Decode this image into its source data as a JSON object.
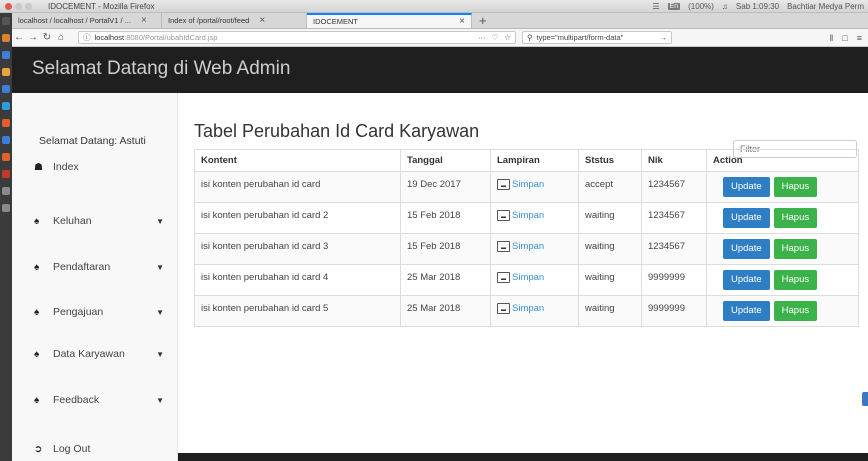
{
  "os": {
    "window_title": "IDOCEMENT - Mozilla Firefox",
    "battery": "(100%)",
    "clock": "Sab 1:09:30",
    "user": "Bachtiar Medya Perm",
    "lang": "En"
  },
  "browser": {
    "tabs": [
      {
        "label": "localhost / localhost / PortalV1 / ..."
      },
      {
        "label": "Index of /portal/root/feed"
      },
      {
        "label": "IDOCEMENT"
      }
    ],
    "url_host": "localhost",
    "url_path": ":8080/Portal/ubahIdCard.jsp",
    "search_text": "type=\"multipart/form-data\""
  },
  "header": {
    "title": "Selamat Datang di Web Admin"
  },
  "sidebar": {
    "greeting": "Selamat Datang: Astuti",
    "items": [
      {
        "label": "Index",
        "icon": "home-icon",
        "caret": false
      },
      {
        "label": "Keluhan",
        "icon": "users-icon",
        "caret": true
      },
      {
        "label": "Pendaftaran",
        "icon": "users-icon",
        "caret": true
      },
      {
        "label": "Pengajuan",
        "icon": "users-icon",
        "caret": true
      },
      {
        "label": "Data Karyawan",
        "icon": "users-icon",
        "caret": true
      },
      {
        "label": "Feedback",
        "icon": "users-icon",
        "caret": true
      },
      {
        "label": "Log Out",
        "icon": "sign-out-icon",
        "caret": false
      }
    ]
  },
  "main": {
    "title": "Tabel Perubahan Id Card Karyawan",
    "filter_placeholder": "Filter",
    "columns": [
      "Kontent",
      "Tanggal",
      "Lampiran",
      "Ststus",
      "Nik",
      "Action"
    ],
    "rows": [
      {
        "kontent": "isi konten perubahan id card",
        "tanggal": "19 Dec 2017",
        "lampiran": "Simpan",
        "status": "accept",
        "nik": "1234567"
      },
      {
        "kontent": "isi konten perubahan id card 2",
        "tanggal": "15 Feb 2018",
        "lampiran": "Simpan",
        "status": "waiting",
        "nik": "1234567"
      },
      {
        "kontent": "isi konten perubahan id card 3",
        "tanggal": "15 Feb 2018",
        "lampiran": "Simpan",
        "status": "waiting",
        "nik": "1234567"
      },
      {
        "kontent": "isi konten perubahan id card 4",
        "tanggal": "25 Mar 2018",
        "lampiran": "Simpan",
        "status": "waiting",
        "nik": "9999999"
      },
      {
        "kontent": "isi konten perubahan id card 5",
        "tanggal": "25 Mar 2018",
        "lampiran": "Simpan",
        "status": "waiting",
        "nik": "9999999"
      }
    ],
    "update_label": "Update",
    "hapus_label": "Hapus"
  },
  "colors": {
    "header_bg": "#1f1f1f",
    "update_btn": "#2e7ec4",
    "hapus_btn": "#3bb24a",
    "link": "#3b8fd6"
  }
}
